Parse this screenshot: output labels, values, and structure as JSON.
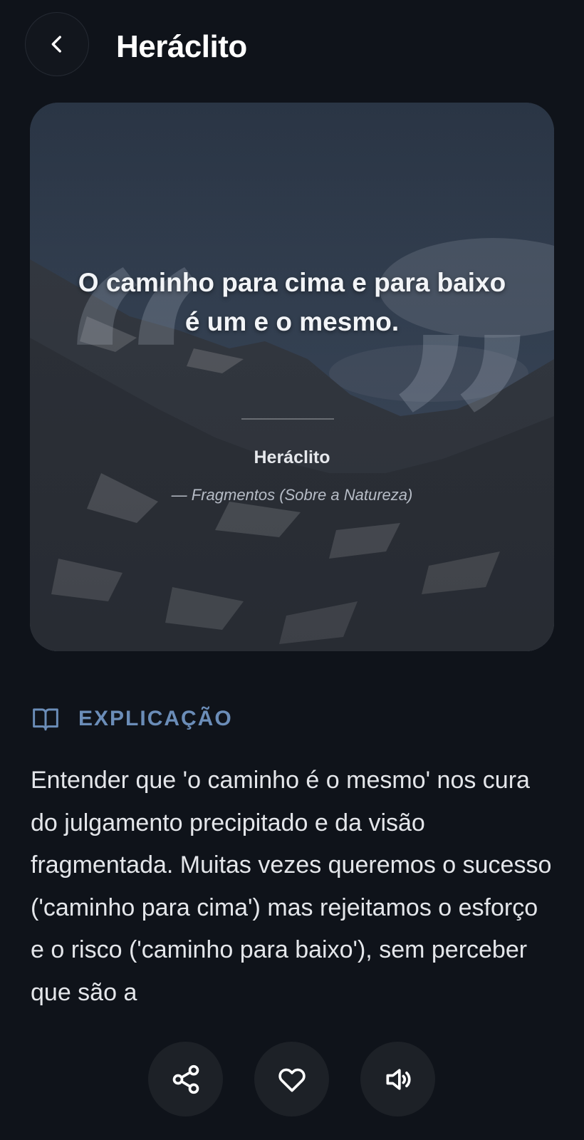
{
  "header": {
    "title": "Heráclito",
    "back_icon": "chevron-left-icon"
  },
  "quote_card": {
    "text": "O caminho para cima e para baixo é um e o mesmo.",
    "author": "Heráclito",
    "source": "— Fragmentos (Sobre a Natureza)",
    "background": "mountain-landscape"
  },
  "explanation": {
    "icon": "open-book-icon",
    "title": "EXPLICAÇÃO",
    "text": "Entender que 'o caminho é o mesmo' nos cura do julgamento precipitado e da visão fragmentada. Muitas vezes queremos o sucesso ('caminho para cima') mas rejeitamos o esforço e o risco ('caminho para baixo'), sem perceber que são a"
  },
  "actions": [
    {
      "name": "share",
      "icon": "share-icon"
    },
    {
      "name": "favorite",
      "icon": "heart-icon"
    },
    {
      "name": "listen",
      "icon": "speaker-icon"
    }
  ],
  "colors": {
    "background": "#0f131a",
    "accent": "#6b8db8",
    "button_bg": "#1d2127"
  }
}
